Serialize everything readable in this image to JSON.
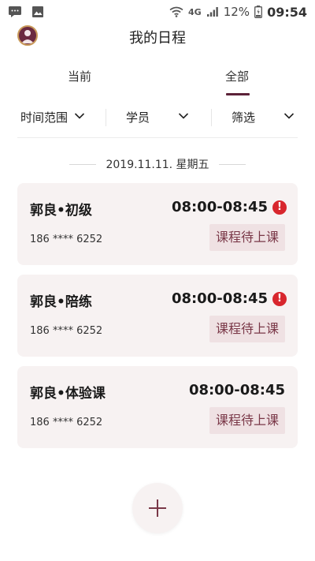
{
  "status_bar": {
    "network": "4G",
    "battery": "12%",
    "time": "09:54"
  },
  "header": {
    "title": "我的日程"
  },
  "tabs": [
    {
      "label": "当前",
      "active": false
    },
    {
      "label": "全部",
      "active": true
    }
  ],
  "filters": [
    {
      "label": "时间范围"
    },
    {
      "label": "学员"
    },
    {
      "label": "筛选"
    }
  ],
  "date_label": "2019.11.11. 星期五",
  "schedule": [
    {
      "name": "郭良•初级",
      "time": "08:00-08:45",
      "alert": true,
      "phone": "186 **** 6252",
      "status": "课程待上课"
    },
    {
      "name": "郭良•陪练",
      "time": "08:00-08:45",
      "alert": true,
      "phone": "186 **** 6252",
      "status": "课程待上课"
    },
    {
      "name": "郭良•体验课",
      "time": "08:00-08:45",
      "alert": false,
      "phone": "186 **** 6252",
      "status": "课程待上课"
    }
  ],
  "colors": {
    "accent": "#5c2238",
    "badge_bg": "#efe1e3",
    "badge_text": "#7a3848",
    "card_bg": "#f7f2f2",
    "alert": "#d8262d"
  },
  "icons": {
    "alert": "!"
  }
}
